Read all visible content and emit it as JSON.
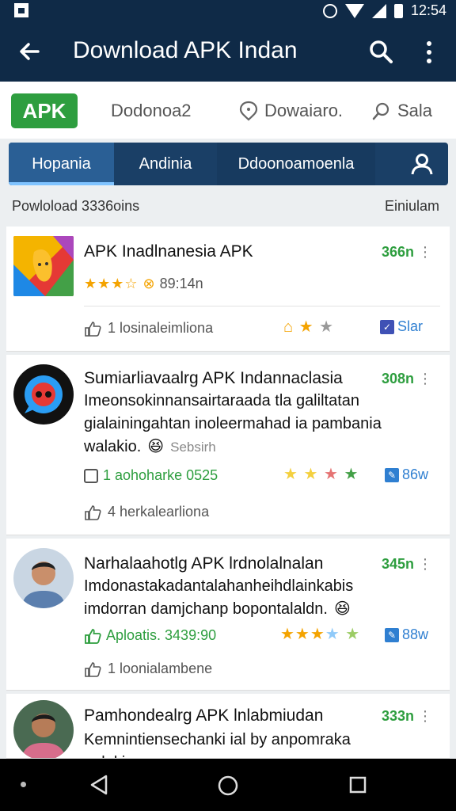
{
  "status": {
    "time": "12:54"
  },
  "appbar": {
    "title": "Download APK Indan"
  },
  "filters": {
    "apk_chip": "APK",
    "item1": "Dodonoa2",
    "item2": "Dowaiaro.",
    "item3": "Sala"
  },
  "tabs": [
    {
      "label": "Hopania"
    },
    {
      "label": "Andinia"
    },
    {
      "label": "Ddoonoamoenla"
    }
  ],
  "section": {
    "left": "Powloload 3336oins",
    "right": "Einiulam"
  },
  "cards": [
    {
      "title": "APK Inadlnanesia APK",
      "time": "366n",
      "meta": "89:14n",
      "like": "1 losinaleimliona",
      "tag": "Slar"
    },
    {
      "title": "Sumiarliavaalrg APK Indannaclasia",
      "time": "308n",
      "desc1": "Imeonsokinnansairtaraada tla galiltatan",
      "desc2": "gialainingahtan inoleermahad ia pambania",
      "desc3": "walakio.",
      "meta": "1 aohoharke 0525",
      "sub": "Sebsirh",
      "like": "4 herkalearliona",
      "tag": "86w"
    },
    {
      "title": "Narhalaahotlg APK lrdnolalnalan",
      "time": "345n",
      "desc1": "Imdonastakadantalahanheihdlainkabis",
      "desc2": "imdorran damjchanp bopontalaldn.",
      "meta": "Aploatis. 3439:90",
      "like": "1 loonialambene",
      "tag": "88w"
    },
    {
      "title": "Pamhondealrg APK lnlabmiudan",
      "time": "333n",
      "desc1": "Kemnintiensechanki ial by anpomraka",
      "desc2": "nalakin"
    }
  ],
  "colors": {
    "primary": "#0f2a47",
    "tab_bg": "#1a3f66",
    "accent_green": "#2e9e3f",
    "accent_blue": "#2f7fd1"
  }
}
